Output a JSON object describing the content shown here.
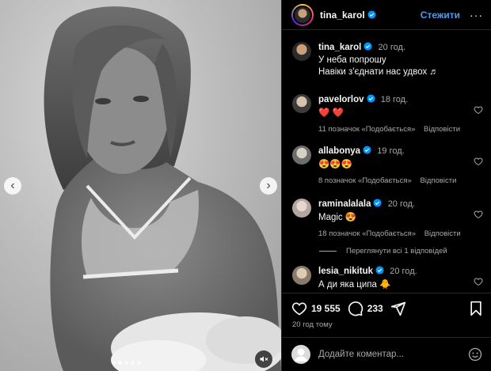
{
  "media": {
    "carousel_dots": 5,
    "active_dot": 1,
    "prev_glyph": "‹",
    "next_glyph": "›",
    "mute_icon": "muted-speaker-icon"
  },
  "header": {
    "username": "tina_karol",
    "verified": true,
    "follow_label": "Стежити",
    "more_glyph": "···"
  },
  "caption": {
    "username": "tina_karol",
    "time": "20 год.",
    "line1": "У неба попрошу",
    "line2": "Навіки з'єднати нас удвох ♬"
  },
  "comments": [
    {
      "username": "pavelorlov",
      "time": "18 год.",
      "text": "❤️ ❤️",
      "likes": "11 позначок «Подобається»",
      "reply": "Відповісти"
    },
    {
      "username": "allabonya",
      "time": "19 год.",
      "text": "😍😍😍",
      "likes": "8 позначок «Подобається»",
      "reply": "Відповісти"
    },
    {
      "username": "raminalalala",
      "time": "20 год.",
      "text": "Magic 😍",
      "likes": "18 позначок «Подобається»",
      "reply": "Відповісти"
    },
    {
      "username": "lesia_nikituk",
      "time": "20 год.",
      "text": "А ди яка ципа 🐥",
      "likes": "",
      "reply": ""
    }
  ],
  "view_replies": "Переглянути всі 1 відповідей",
  "actions": {
    "likes_count": "19 555",
    "comments_count": "233",
    "posted": "20 год тому"
  },
  "add_comment": {
    "placeholder": "Додайте коментар..."
  },
  "colors": {
    "background": "#000000",
    "link_blue": "#4a9df8",
    "muted_text": "#a8a8a8",
    "verified_blue": "#0095f6",
    "divider": "#262626"
  }
}
